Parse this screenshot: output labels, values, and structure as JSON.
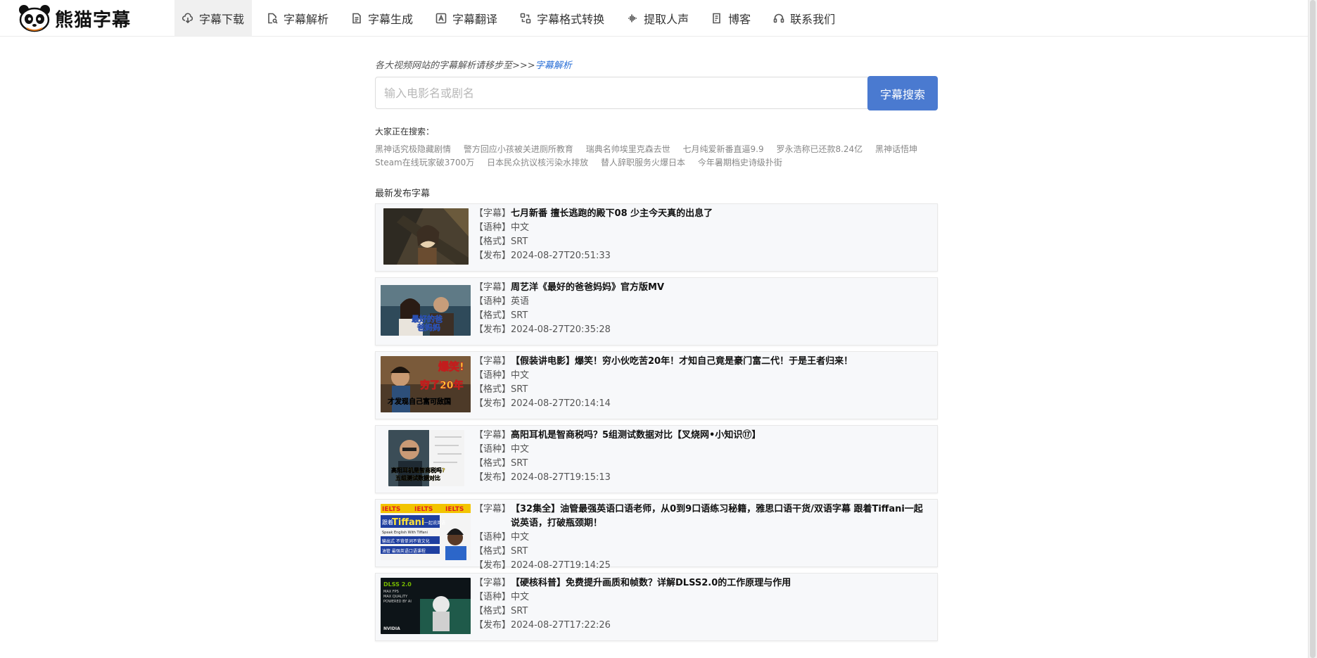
{
  "logo": {
    "text": "熊猫字幕"
  },
  "nav": {
    "items": [
      {
        "label": "字幕下载",
        "icon": "cloud-download-icon"
      },
      {
        "label": "字幕解析",
        "icon": "file-search-icon"
      },
      {
        "label": "字幕生成",
        "icon": "file-text-icon"
      },
      {
        "label": "字幕翻译",
        "icon": "translate-icon"
      },
      {
        "label": "字幕格式转换",
        "icon": "convert-icon"
      },
      {
        "label": "提取人声",
        "icon": "waveform-icon"
      },
      {
        "label": "博客",
        "icon": "edit-doc-icon"
      },
      {
        "label": "联系我们",
        "icon": "headset-icon"
      }
    ]
  },
  "tip": {
    "text": "各大视频网站的字幕解析请移步至>>>",
    "link": "字幕解析"
  },
  "search": {
    "placeholder": "输入电影名或剧名",
    "button": "字幕搜索"
  },
  "hot": {
    "title": "大家正在搜索：",
    "items": [
      "黑神话究极隐藏剧情",
      "警方回应小孩被关进厕所教育",
      "瑞典名帅埃里克森去世",
      "七月纯爱新番直逼9.9",
      "罗永浩称已还款8.24亿",
      "黑神话悟坤",
      "Steam在线玩家破3700万",
      "日本民众抗议核污染水排放",
      "替人辞职服务火爆日本",
      "今年暑期档史诗级扑街"
    ]
  },
  "latest": {
    "title": "最新发布字幕",
    "labels": {
      "subtitle": "【字幕】",
      "language": "【语种】",
      "format": "【格式】",
      "published": "【发布】"
    },
    "items": [
      {
        "title": "七月新番 擅长逃跑的殿下08 少主今天真的出息了",
        "language": "中文",
        "format": "SRT",
        "published": "2024-08-27T20:51:33"
      },
      {
        "title": "周艺洋《最好的爸爸妈妈》官方版MV",
        "language": "英语",
        "format": "SRT",
        "published": "2024-08-27T20:35:28"
      },
      {
        "title": "【假装讲电影】爆笑！穷小伙吃苦20年！才知自己竟是豪门富二代！于是王者归来！",
        "language": "中文",
        "format": "SRT",
        "published": "2024-08-27T20:14:14"
      },
      {
        "title": "高阳耳机是智商税吗？5组测试数据对比【叉烧网•小知识⑰】",
        "language": "中文",
        "format": "SRT",
        "published": "2024-08-27T19:15:13"
      },
      {
        "title": "【32集全】油管最强英语口语老师，从0到9口语练习秘籍，雅思口语干货/双语字幕 跟着Tiffani一起说英语，打破瓶颈期！",
        "language": "中文",
        "format": "SRT",
        "published": "2024-08-27T19:14:25"
      },
      {
        "title": "【硬核科普】免费提升画质和帧数？详解DLSS2.0的工作原理与作用",
        "language": "中文",
        "format": "SRT",
        "published": "2024-08-27T17:22:26"
      }
    ]
  },
  "thumbs": [
    {
      "texts": []
    },
    {
      "texts": [
        "最好的爸",
        "爸妈妈"
      ]
    },
    {
      "texts": [
        "爆笑!",
        "穷了20年",
        "才发现自己富可敌国"
      ]
    },
    {
      "texts": [
        "高阳耳机是智商税吗?",
        "五组测试数据对比"
      ]
    },
    {
      "texts": [
        "IELTS",
        "IELTS",
        "IELTS",
        "跟着",
        "Tiffani",
        "一起说英语",
        "Speak English With Tiffani",
        "输出式 不背单词不背文化",
        "油管 最强英语口语课程"
      ]
    },
    {
      "texts": [
        "DLSS 2.0",
        "MAX FPS",
        "MAX QUALITY",
        "POWERED BY AI",
        "NVIDIA"
      ]
    }
  ],
  "colors": {
    "accent": "#4a7ad0",
    "link": "#2a6fd6"
  }
}
